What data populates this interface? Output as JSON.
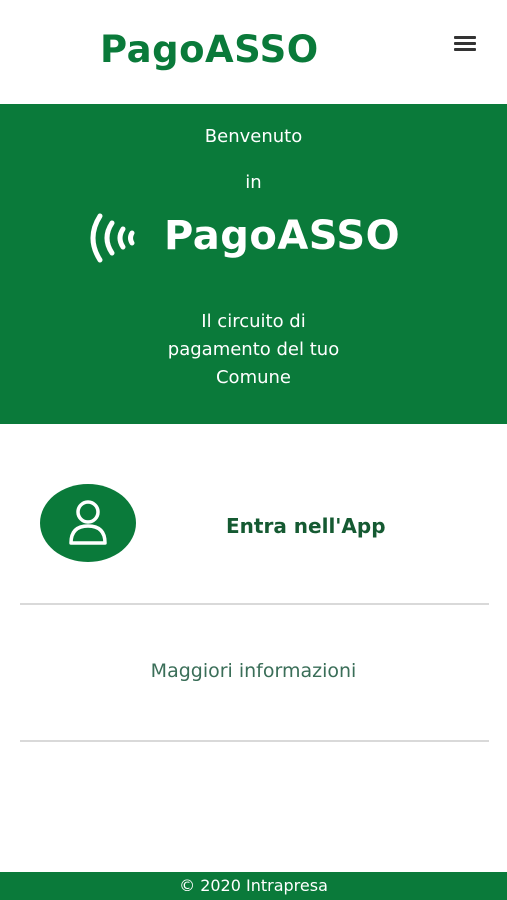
{
  "header": {
    "brand": "PagoASSO",
    "menu_icon": "hamburger-menu-icon"
  },
  "hero": {
    "welcome": "Benvenuto",
    "in": "in",
    "logo_text": "PagoASSO",
    "logo_icon": "contactless-waves-icon",
    "tagline_lines": [
      "Il circuito di",
      "pagamento del tuo",
      "Comune"
    ]
  },
  "main": {
    "enter_label": "Entra nell'App",
    "enter_icon": "user-icon",
    "more_info": "Maggiori informazioni"
  },
  "footer": {
    "copyright": "© 2020 Intrapresa"
  },
  "colors": {
    "brand_green": "#0a7a3a",
    "text_dark_green": "#155a32",
    "link_green": "#3a6e58"
  }
}
